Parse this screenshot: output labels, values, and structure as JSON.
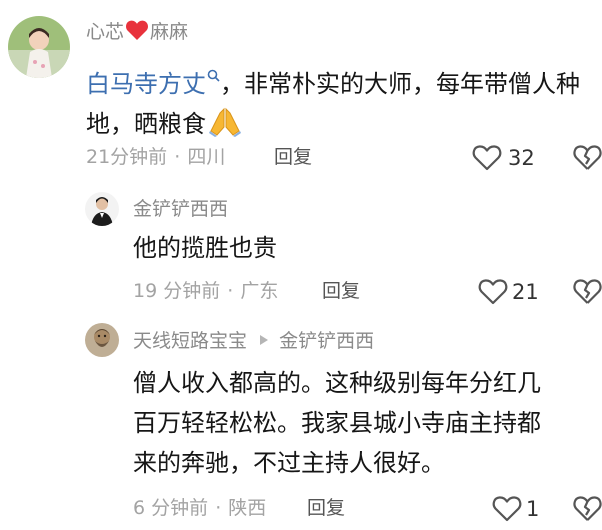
{
  "comments": [
    {
      "user": "心芯",
      "user_suffix": "麻麻",
      "mention": "白马寺方丈",
      "text": "，非常朴实的大师，每年带僧人种地，晒粮食",
      "time": "21分钟前",
      "location": "四川",
      "reply": "回复",
      "likes": "32"
    },
    {
      "user": "金铲铲西西",
      "text": "他的揽胜也贵",
      "time": "19 分钟前",
      "location": "广东",
      "reply": "回复",
      "likes": "21"
    },
    {
      "user": "天线短路宝宝",
      "reply_to": "金铲铲西西",
      "text_line1": "僧人收入都高的。这种级别每年分红几",
      "text_line2": "百万轻轻松松。我家县城小寺庙主持都",
      "text_line3": "来的奔驰，不过主持人很好。",
      "time": "6 分钟前",
      "location": "陕西",
      "reply": "回复",
      "likes": "1"
    }
  ],
  "separator": "·",
  "colors": {
    "mention": "#3d6fb0",
    "heart_emoji": "#e8323c"
  }
}
